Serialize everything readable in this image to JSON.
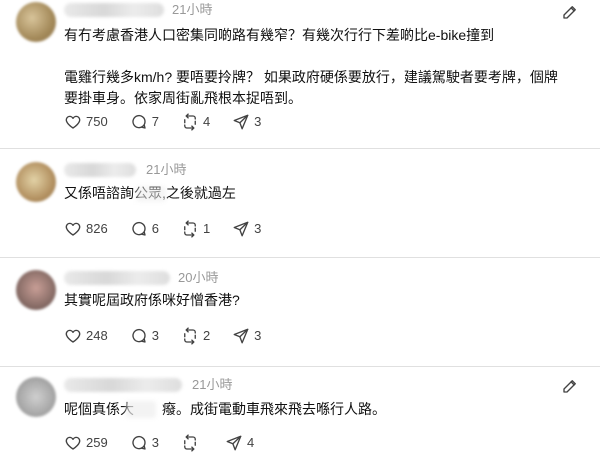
{
  "posts": [
    {
      "timestamp": "21小時",
      "lines": [
        "有冇考慮香港人口密集同啲路有幾窄？有幾次行行下差啲比e-bike撞到",
        "",
        "電雞行幾多km/h? 要唔要拎牌？ 如果政府硬係要放行，建議駕駛者要考牌，個牌",
        "要掛車身。依家周街亂飛根本捉唔到。"
      ],
      "likes": "750",
      "replies": "7",
      "reposts": "4",
      "shares": "3"
    },
    {
      "timestamp": "21小時",
      "lines": [
        "又係唔諮詢公眾,之後就過左"
      ],
      "likes": "826",
      "replies": "6",
      "reposts": "1",
      "shares": "3"
    },
    {
      "timestamp": "20小時",
      "lines": [
        "其實呢屆政府係咪好憎香港?"
      ],
      "likes": "248",
      "replies": "3",
      "reposts": "2",
      "shares": "3"
    },
    {
      "timestamp": "21小時",
      "lines": [
        "呢個真係大　　癈。成街電動車飛來飛去喺行人路。"
      ],
      "likes": "259",
      "replies": "3",
      "reposts": "",
      "shares": "4"
    }
  ],
  "colors": {
    "text": "#101010",
    "muted": "#999999",
    "icon": "#424242",
    "divider": "#e0e0e0"
  },
  "icons": [
    "more-icon",
    "heart-icon",
    "comment-icon",
    "repost-icon",
    "share-icon"
  ]
}
